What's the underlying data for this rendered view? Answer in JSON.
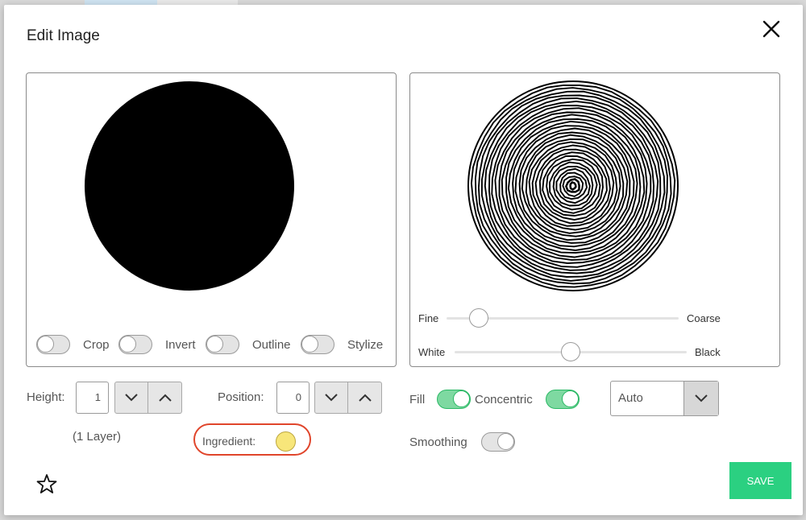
{
  "dialog": {
    "title": "Edit Image",
    "close_icon": "close-icon"
  },
  "left_panel": {
    "toggles": [
      {
        "label": "Crop",
        "on": false
      },
      {
        "label": "Invert",
        "on": false
      },
      {
        "label": "Outline",
        "on": false
      },
      {
        "label": "Stylize",
        "on": false
      }
    ]
  },
  "right_panel": {
    "sliders": [
      {
        "left_label": "Fine",
        "right_label": "Coarse",
        "value": 0.14
      },
      {
        "left_label": "White",
        "right_label": "Black",
        "value": 0.5
      }
    ]
  },
  "height": {
    "label": "Height:",
    "value": "1",
    "note": "(1 Layer)"
  },
  "position": {
    "label": "Position:",
    "value": "0"
  },
  "ingredient": {
    "label": "Ingredient:",
    "color": "#f7e67a"
  },
  "fill": {
    "label": "Fill",
    "on": true
  },
  "concentric": {
    "label": "Concentric",
    "on": true
  },
  "smoothing": {
    "label": "Smoothing",
    "on": false
  },
  "mode_select": {
    "value": "Auto"
  },
  "actions": {
    "save_label": "SAVE",
    "favorite_icon": "star-icon"
  },
  "colors": {
    "accent": "#2bd081",
    "highlight": "#e0452b"
  }
}
